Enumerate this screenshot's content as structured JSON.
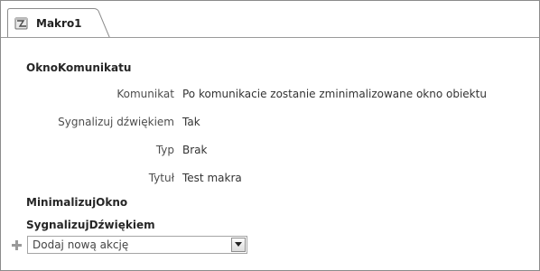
{
  "tab": {
    "title": "Makro1",
    "icon": "macro-icon"
  },
  "macro": {
    "actions": [
      {
        "name": "OknoKomunikatu",
        "arguments": [
          {
            "label": "Komunikat",
            "value": "Po komunikacie zostanie zminimalizowane okno obiektu"
          },
          {
            "label": "Sygnalizuj dźwiękiem",
            "value": "Tak"
          },
          {
            "label": "Typ",
            "value": "Brak"
          },
          {
            "label": "Tytuł",
            "value": "Test makra"
          }
        ]
      },
      {
        "name": "MinimalizujOkno"
      },
      {
        "name": "SygnalizujDźwiękiem"
      }
    ]
  },
  "add_action": {
    "icon": "plus-icon",
    "text": "Dodaj nową akcję",
    "dropdown_icon": "chevron-down-icon"
  },
  "colors": {
    "border": "#8c8c8c",
    "text": "#333333",
    "label": "#4d4d4d"
  }
}
